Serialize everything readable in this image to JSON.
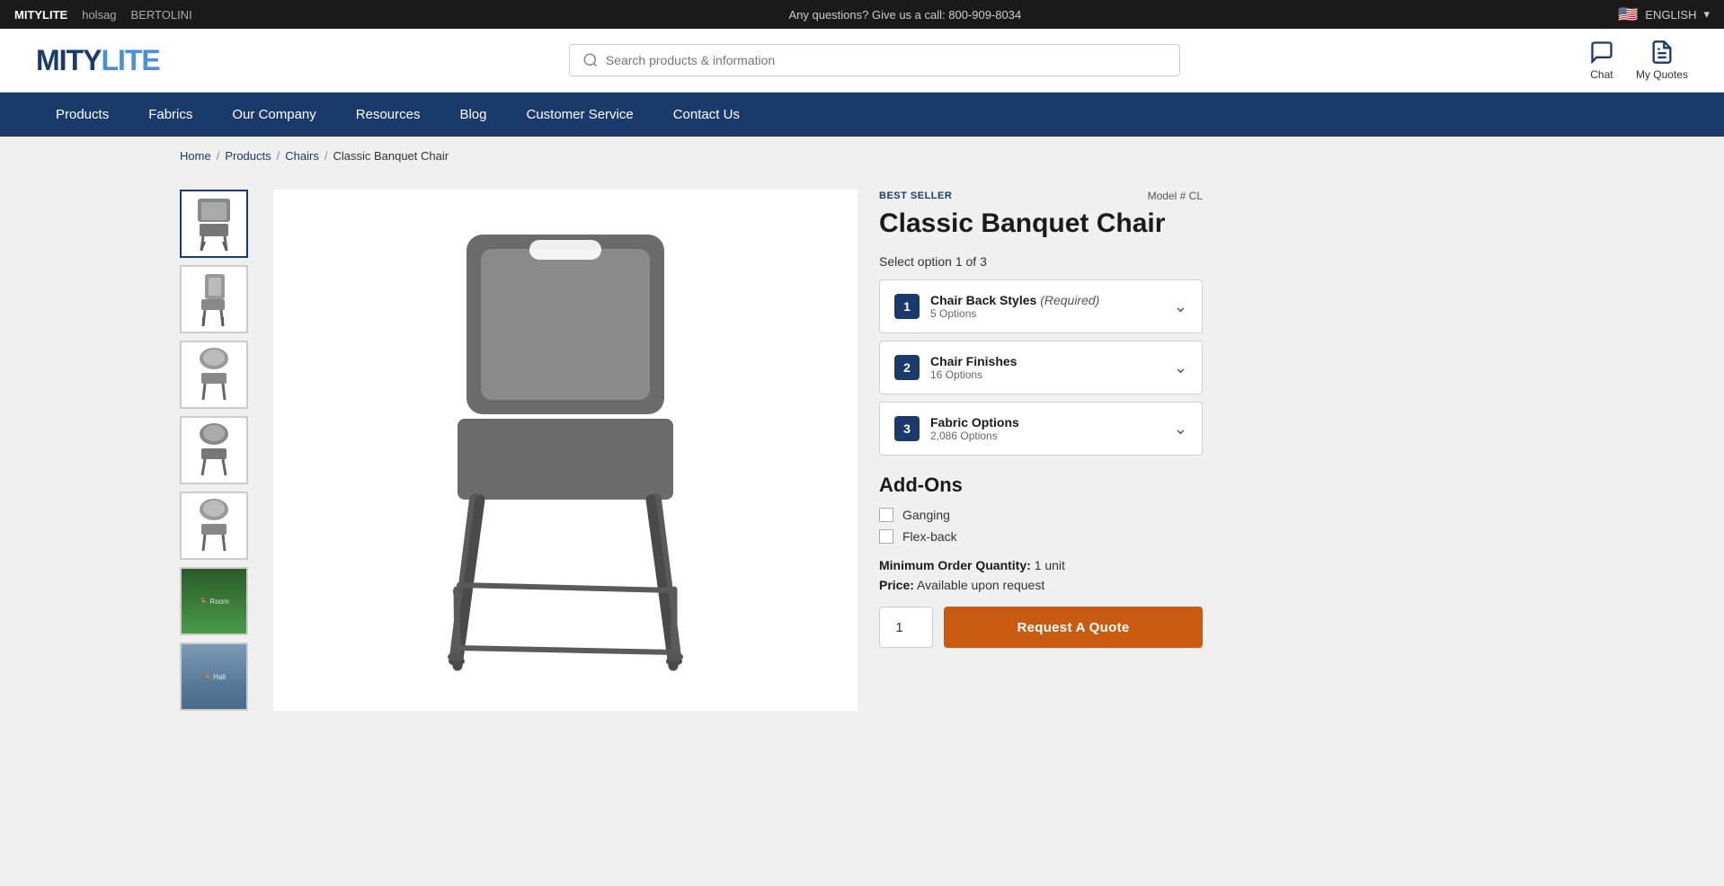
{
  "topbar": {
    "brands": [
      "MITYLITE",
      "holsag",
      "BERTOLINI"
    ],
    "active_brand": "MITYLITE",
    "phone_text": "Any questions? Give us a call: 800-909-8034",
    "lang": "ENGLISH"
  },
  "header": {
    "logo": "MITYLITE",
    "search_placeholder": "Search products & information",
    "chat_label": "Chat",
    "quotes_label": "My Quotes"
  },
  "nav": {
    "items": [
      "Products",
      "Fabrics",
      "Our Company",
      "Resources",
      "Blog",
      "Customer Service",
      "Contact Us"
    ]
  },
  "breadcrumb": {
    "home": "Home",
    "products": "Products",
    "chairs": "Chairs",
    "current": "Classic Banquet Chair"
  },
  "product": {
    "badge": "BEST SELLER",
    "model": "Model # CL",
    "title": "Classic Banquet Chair",
    "select_label": "Select option 1 of 3",
    "options": [
      {
        "num": "1",
        "name": "Chair Back Styles",
        "required": "(Required)",
        "sub": "5 Options"
      },
      {
        "num": "2",
        "name": "Chair Finishes",
        "required": "",
        "sub": "16 Options"
      },
      {
        "num": "3",
        "name": "Fabric Options",
        "required": "",
        "sub": "2,086 Options"
      }
    ],
    "addons_title": "Add-Ons",
    "addons": [
      "Ganging",
      "Flex-back"
    ],
    "moq_label": "Minimum Order Quantity:",
    "moq_value": "1 unit",
    "price_label": "Price:",
    "price_value": "Available upon request",
    "qty_default": "1",
    "quote_btn": "Request A Quote"
  }
}
